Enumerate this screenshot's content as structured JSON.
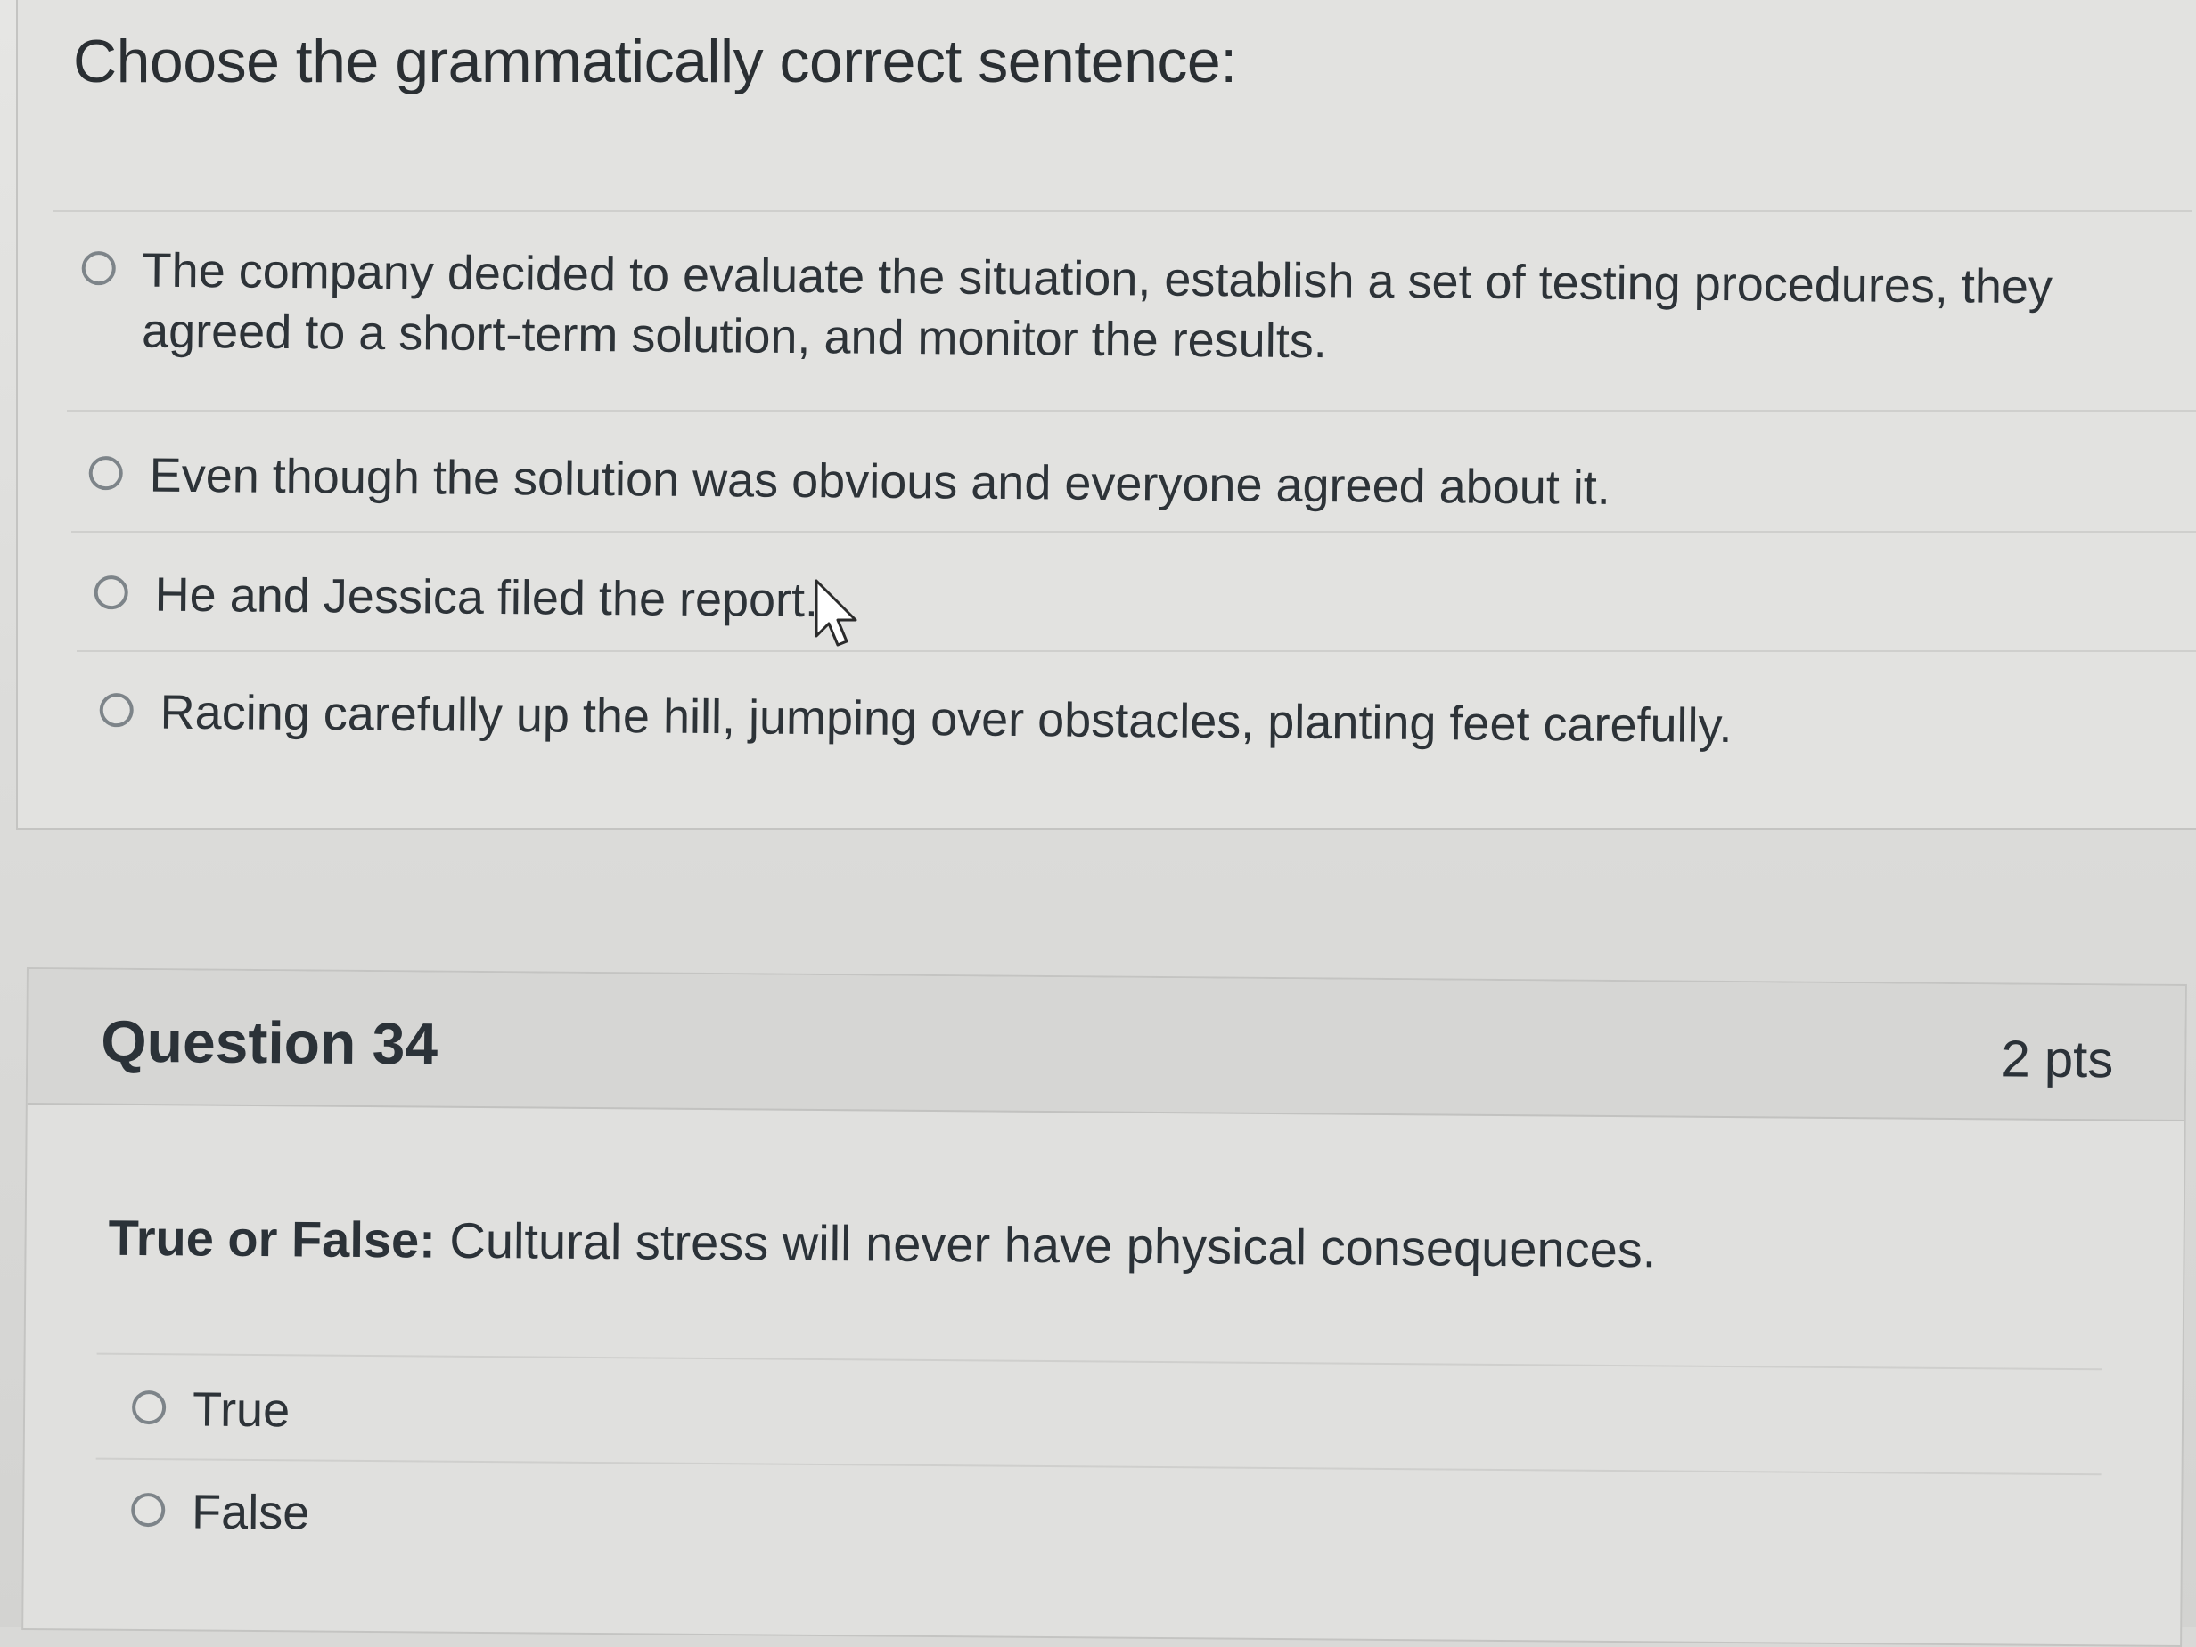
{
  "previous_question": {
    "prompt": "Choose the grammatically correct sentence:",
    "answers": [
      {
        "label_line1": "The company decided to evaluate the situation, establish a set of testing procedures, they",
        "label_line2": "agreed to a short-term solution, and monitor the results."
      },
      {
        "label": "Even though the solution was obvious and everyone agreed about it."
      },
      {
        "label": "He and Jessica filed the report."
      },
      {
        "label": "Racing carefully up the hill, jumping over obstacles, planting feet carefully."
      }
    ]
  },
  "question_34": {
    "title": "Question 34",
    "points": "2 pts",
    "prompt_bold": "True or False:",
    "prompt_rest": " Cultural stress will never have physical consequences.",
    "answers": [
      {
        "label": "True"
      },
      {
        "label": "False"
      }
    ]
  },
  "icons": {
    "radio": "radio-button-unselected-icon",
    "cursor": "mouse-pointer-cursor-icon"
  }
}
